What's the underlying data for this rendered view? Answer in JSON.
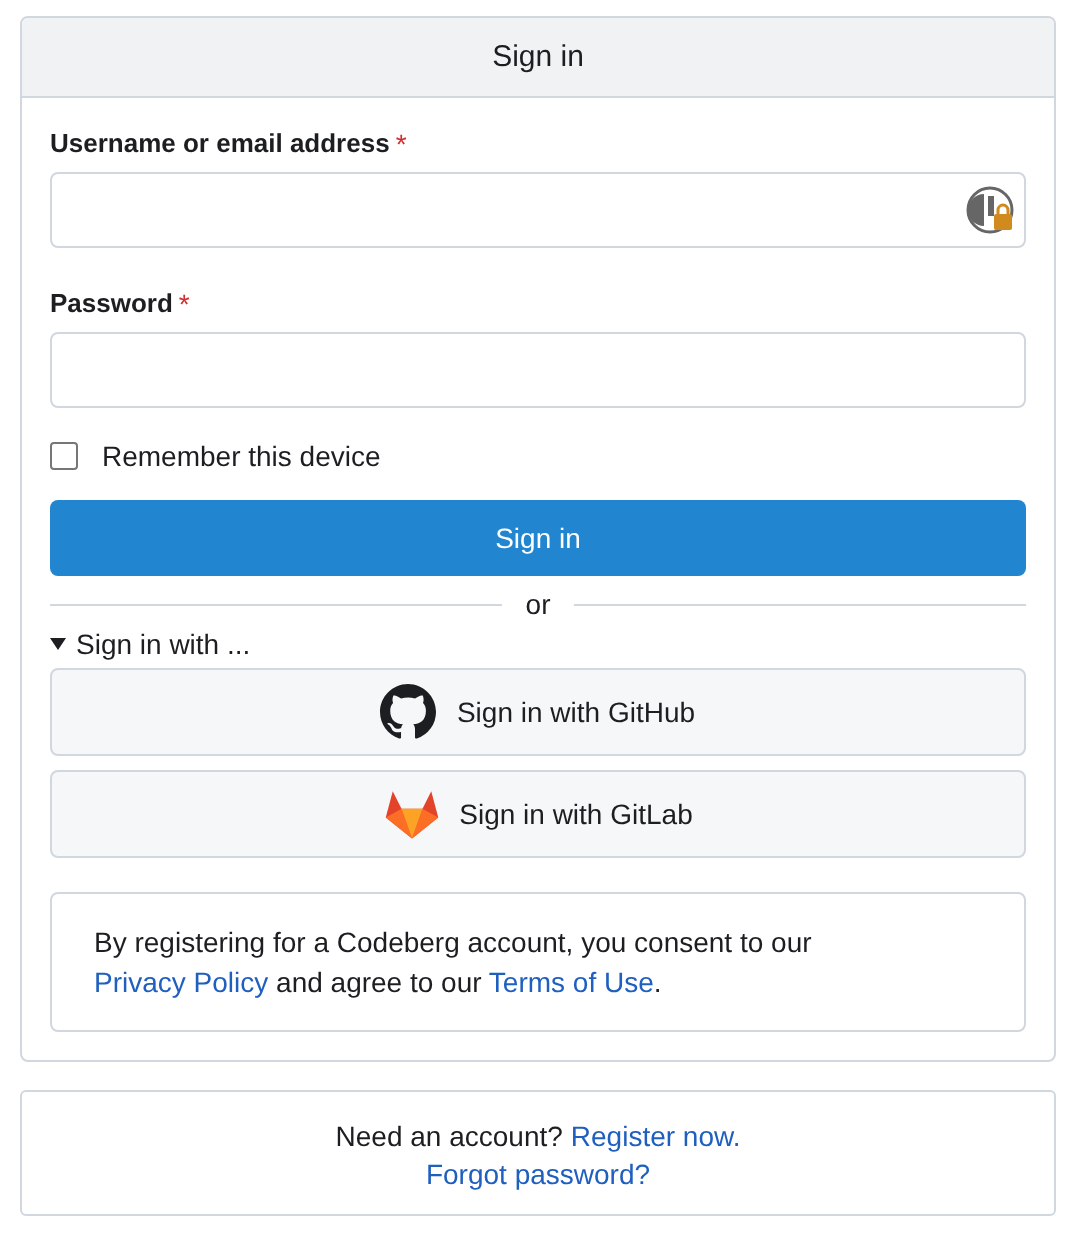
{
  "header": {
    "title": "Sign in"
  },
  "fields": [
    {
      "label": "Username or email address",
      "required_mark": "*",
      "has_manager_icon": true
    },
    {
      "label": "Password",
      "required_mark": "*",
      "has_manager_icon": false
    }
  ],
  "remember": {
    "label": "Remember this device",
    "checked": false
  },
  "submit": {
    "label": "Sign in"
  },
  "divider": {
    "label": "or"
  },
  "oauth": {
    "label": "Sign in with ...",
    "expanded": true,
    "providers": [
      {
        "kind": "github",
        "label": "Sign in with GitHub"
      },
      {
        "kind": "gitlab",
        "label": "Sign in with GitLab"
      }
    ]
  },
  "consent": {
    "parts": [
      {
        "kind": "text",
        "text": "By registering for a Codeberg account, you consent to our "
      },
      {
        "kind": "link",
        "text": "Privacy Policy"
      },
      {
        "kind": "text",
        "text": " and agree to our "
      },
      {
        "kind": "link",
        "text": "Terms of Use"
      },
      {
        "kind": "text",
        "text": "."
      }
    ]
  },
  "footer": {
    "question": "Need an account?",
    "register_link": "Register now.",
    "forgot_link": "Forgot password?"
  }
}
